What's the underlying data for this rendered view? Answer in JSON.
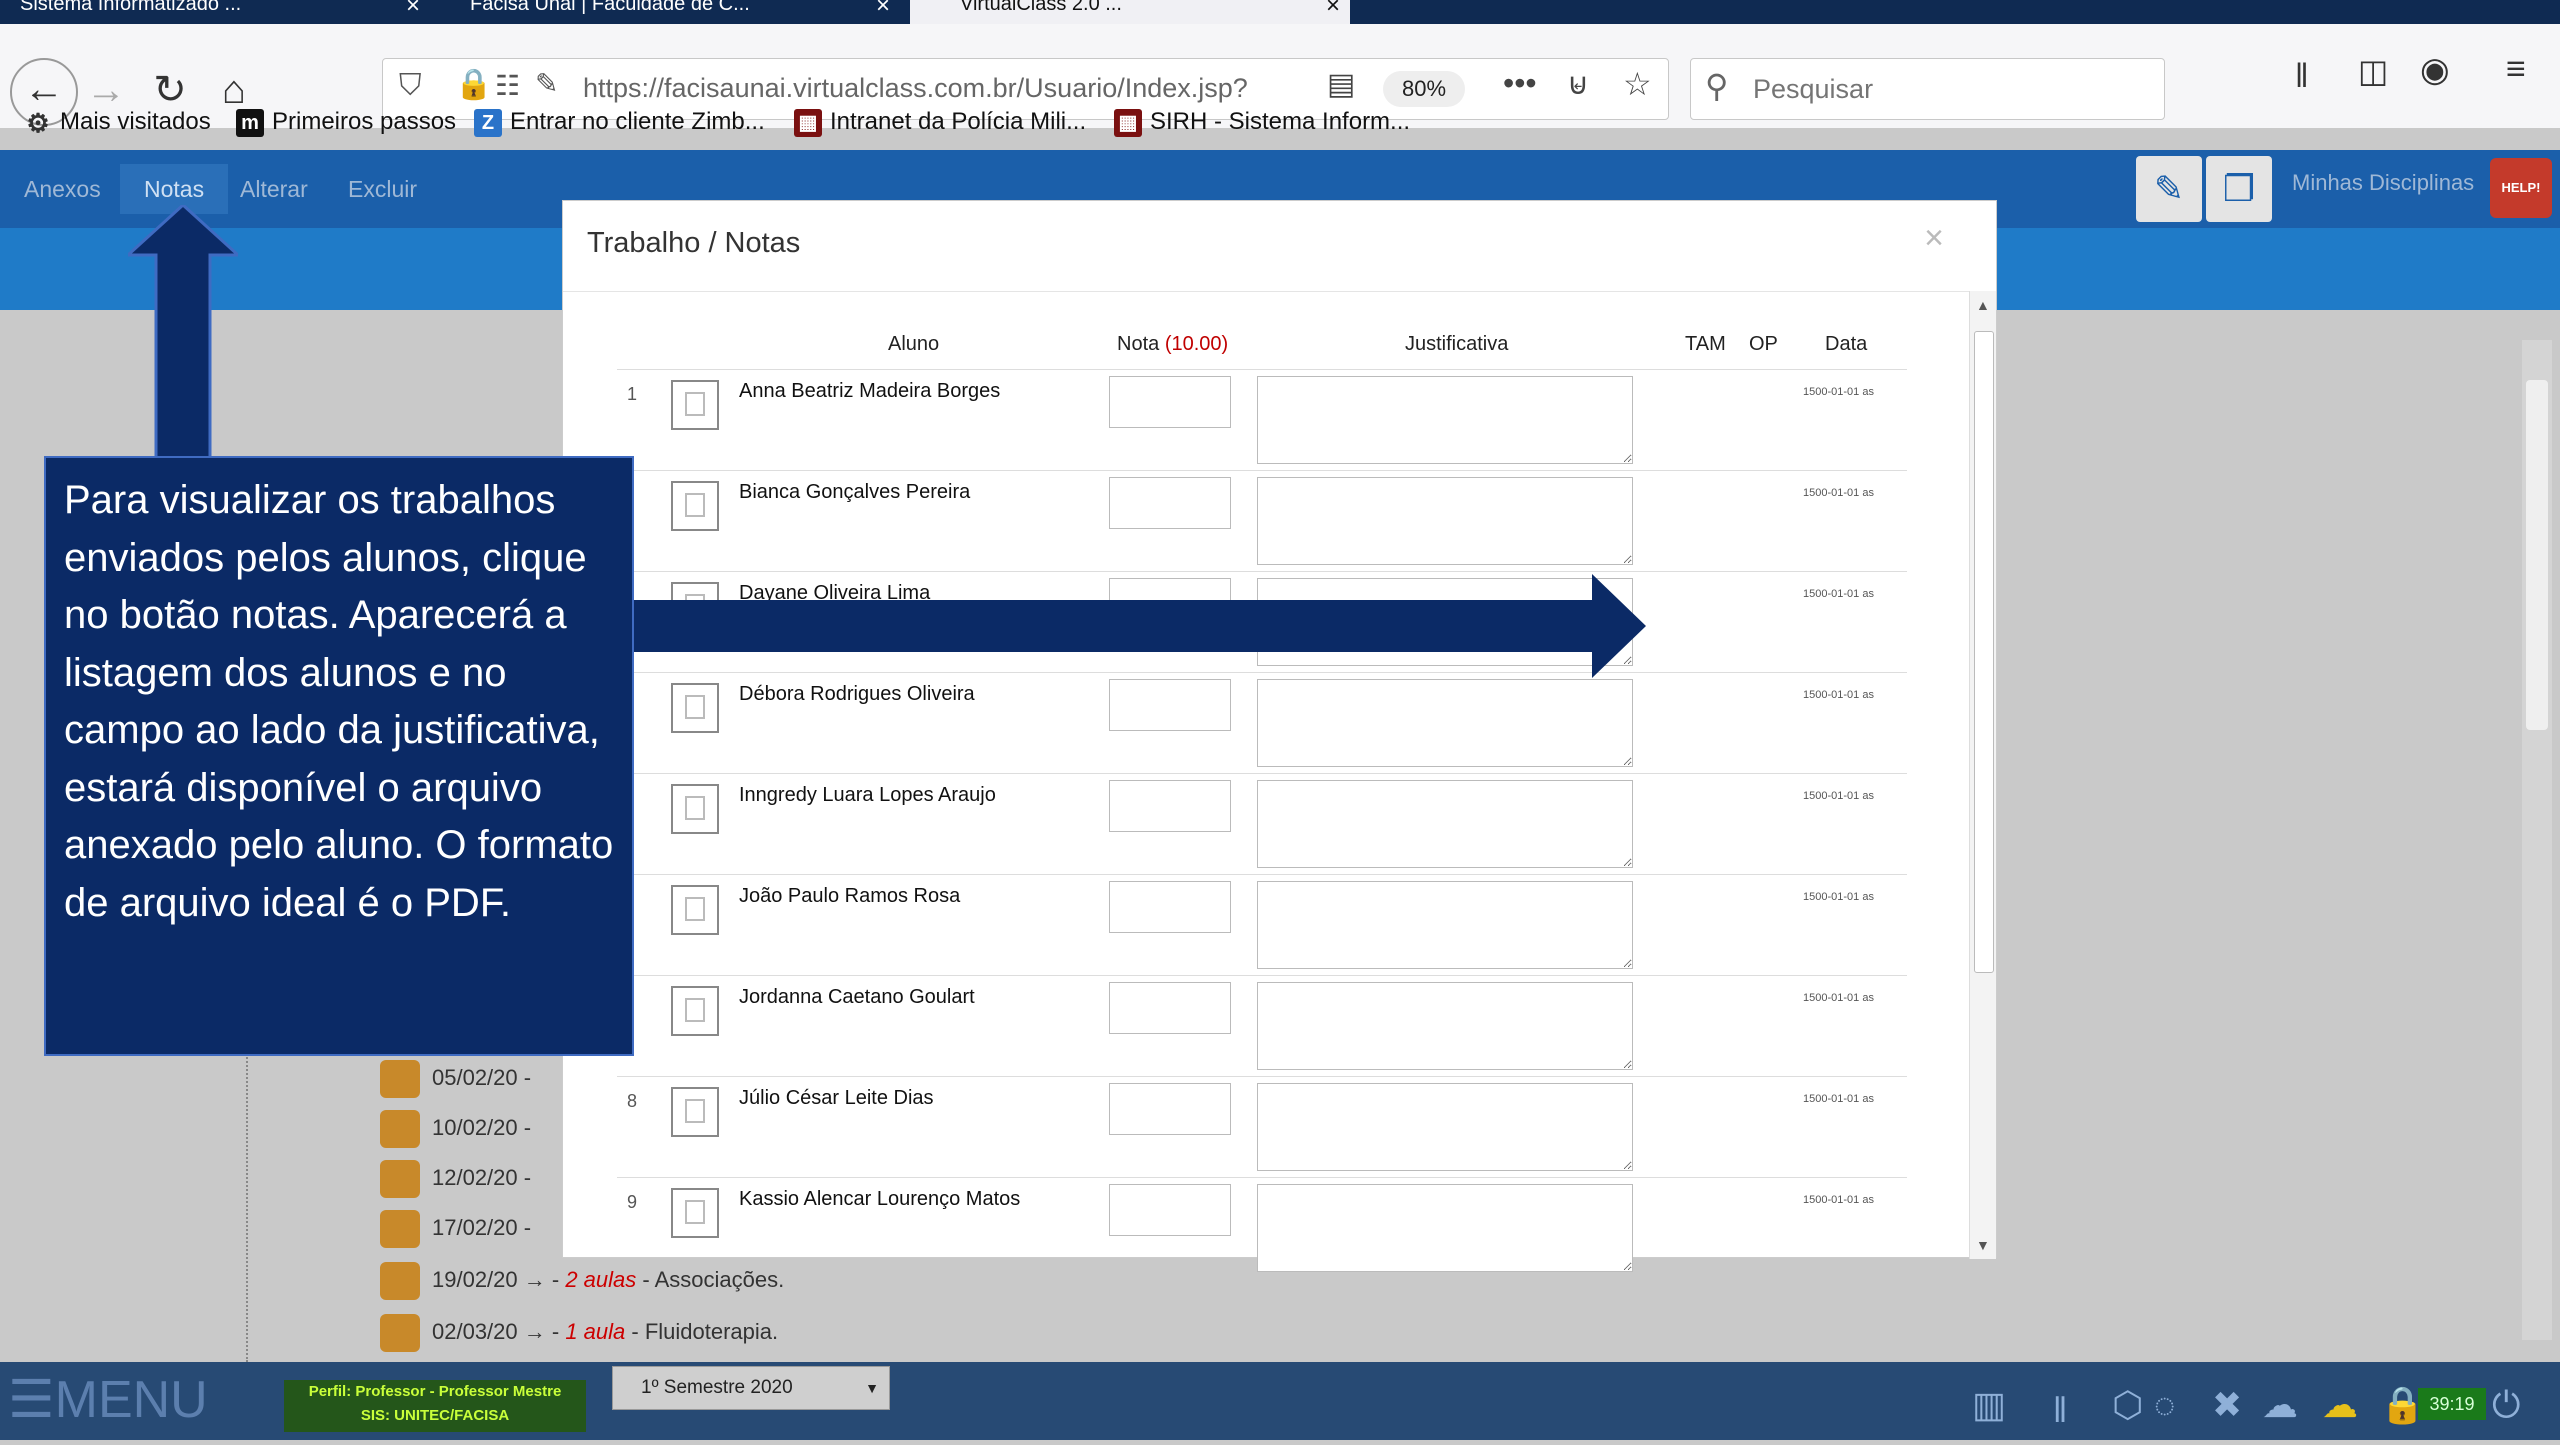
{
  "browser": {
    "tabs": [
      {
        "label": "Sistema Informatizado ...",
        "active": false
      },
      {
        "label": "Facisa Unai | Faculdade de C...",
        "active": false
      },
      {
        "label": "VirtualClass 2.0 ...",
        "active": true
      }
    ],
    "url": "https://facisaunai.virtualclass.com.br/Usuario/Index.jsp?",
    "zoom": "80%",
    "search_placeholder": "Pesquisar",
    "bookmarks": [
      {
        "label": "Mais visitados",
        "icon": "gear-icon"
      },
      {
        "label": "Primeiros passos",
        "icon": "m"
      },
      {
        "label": "Entrar no cliente Zimb...",
        "icon": "Z"
      },
      {
        "label": "Intranet da Polícia Mili...",
        "icon": "pm"
      },
      {
        "label": "SIRH - Sistema Inform...",
        "icon": "pm"
      }
    ]
  },
  "app": {
    "menu_tabs": [
      "Anexos",
      "Notas",
      "Alterar",
      "Excluir"
    ],
    "minhas_disciplinas": "Minhas Disciplinas",
    "help_label": "HELP!"
  },
  "modal": {
    "title": "Trabalho / Notas",
    "close_symbol": "×",
    "columns": {
      "aluno": "Aluno",
      "nota": "Nota",
      "nota_max": "(10.00)",
      "justificativa": "Justificativa",
      "tam": "TAM",
      "op": "OP",
      "data": "Data"
    },
    "rows": [
      {
        "num": "1",
        "name": "Anna Beatriz Madeira Borges",
        "date": "1500-01-01 as"
      },
      {
        "num": "",
        "name": "Bianca Gonçalves Pereira",
        "date": "1500-01-01 as"
      },
      {
        "num": "",
        "name": "Dayane Oliveira Lima",
        "date": "1500-01-01 as"
      },
      {
        "num": "",
        "name": "Débora Rodrigues Oliveira",
        "date": "1500-01-01 as"
      },
      {
        "num": "",
        "name": "Inngredy Luara Lopes Araujo",
        "date": "1500-01-01 as"
      },
      {
        "num": "",
        "name": "João Paulo Ramos Rosa",
        "date": "1500-01-01 as"
      },
      {
        "num": "",
        "name": "Jordanna Caetano Goulart",
        "date": "1500-01-01 as"
      },
      {
        "num": "8",
        "name": "Júlio César Leite Dias",
        "date": "1500-01-01 as"
      },
      {
        "num": "9",
        "name": "Kassio Alencar Lourenço Matos",
        "date": "1500-01-01 as"
      }
    ]
  },
  "background_list": [
    {
      "date": "05/02/20 -",
      "aulas": "",
      "topic": ""
    },
    {
      "date": "10/02/20 -",
      "aulas": "",
      "topic": ""
    },
    {
      "date": "12/02/20 -",
      "aulas": "",
      "topic": ""
    },
    {
      "date": "17/02/20 -",
      "aulas": "",
      "topic": ""
    },
    {
      "date": "19/02/20 → -",
      "aulas": "2 aulas",
      "topic": "- Associações."
    },
    {
      "date": "02/03/20 → -",
      "aulas": "1 aula",
      "topic": "- Fluidoterapia."
    }
  ],
  "annotation": {
    "text": "Para visualizar os trabalhos enviados pelos alunos, clique no botão notas. Aparecerá a listagem dos alunos e no campo ao lado da justificativa, estará disponível o arquivo anexado pelo aluno. O formato de arquivo ideal é o PDF."
  },
  "bottom": {
    "menu_label": "MENU",
    "perfil_line1": "Perfil: Professor - Professor Mestre",
    "perfil_line2": "SIS: UNITEC/FACISA",
    "semestre": "1º Semestre 2020",
    "clock": "39:19"
  },
  "colors": {
    "annotation_bg": "#0b2a66",
    "app_header": "#1b5faa",
    "nota_max": "#c00000"
  }
}
